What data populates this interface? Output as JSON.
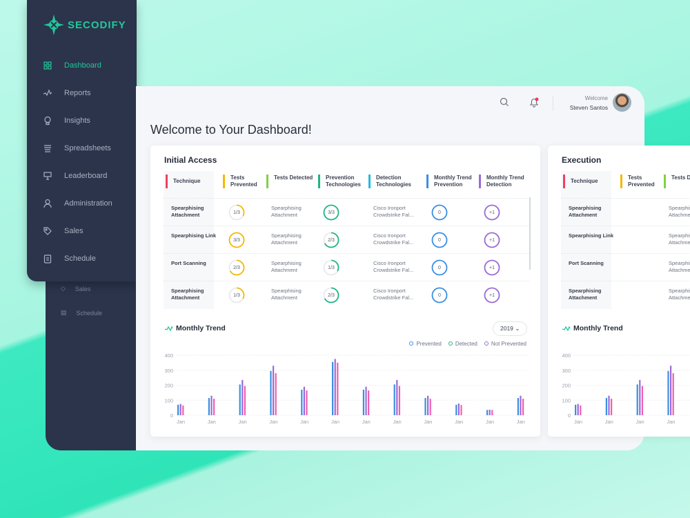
{
  "brand": {
    "name": "SECODIFY",
    "accent": "#20c99a"
  },
  "sidebar": {
    "items": [
      {
        "label": "Dashboard",
        "icon": "grid-icon",
        "active": true
      },
      {
        "label": "Reports",
        "icon": "pulse-icon"
      },
      {
        "label": "Insights",
        "icon": "lightbulb-icon"
      },
      {
        "label": "Spreadsheets",
        "icon": "stack-icon"
      },
      {
        "label": "Leaderboard",
        "icon": "presentation-icon"
      },
      {
        "label": "Administration",
        "icon": "user-icon"
      },
      {
        "label": "Sales",
        "icon": "tag-icon"
      },
      {
        "label": "Schedule",
        "icon": "clipboard-icon"
      }
    ],
    "ghost_items": [
      {
        "label": "Sales",
        "icon": "tag-icon"
      },
      {
        "label": "Schedule",
        "icon": "clipboard-icon"
      }
    ]
  },
  "header": {
    "welcome": "Welcome",
    "user": "Steven Santos",
    "notification_dot": "#f03a5a"
  },
  "page_title": "Welcome to Your Dashboard!",
  "cards": [
    {
      "title": "Initial Access",
      "columns": [
        {
          "label": "Technique",
          "color": "#f0405e"
        },
        {
          "label": "Tests Prevented",
          "color": "#f5b800"
        },
        {
          "label": "Tests Detected",
          "color": "#7fd148"
        },
        {
          "label": "Prevention Technologies",
          "color": "#1db584"
        },
        {
          "label": "Detection Technologies",
          "color": "#22b8e0"
        },
        {
          "label": "Monthly Trend Prevention",
          "color": "#3b8fe0"
        },
        {
          "label": "Monthly Trend Detection",
          "color": "#9b6ad8"
        }
      ],
      "rows": [
        {
          "technique": "Spearphising Attachment",
          "prevented": "1/3",
          "prevented_frac": 0.33,
          "detected": "Spearphising Attachment",
          "prevention_tech": "3/3",
          "prevention_frac": 1,
          "detection_tech": "Cisco Ironport Crowdstrike Fal...",
          "trend_prevention": "0",
          "trend_detection": "+1"
        },
        {
          "technique": "Spearphising Link",
          "prevented": "3/3",
          "prevented_frac": 1,
          "detected": "Spearphising Attachment",
          "prevention_tech": "2/3",
          "prevention_frac": 0.67,
          "detection_tech": "Cisco Ironport Crowdstrike Fal...",
          "trend_prevention": "0",
          "trend_detection": "+1"
        },
        {
          "technique": "Port Scanning",
          "prevented": "2/3",
          "prevented_frac": 0.67,
          "detected": "Spearphising Attachment",
          "prevention_tech": "1/3",
          "prevention_frac": 0.33,
          "detection_tech": "Cisco Ironport Crowdstrike Fal...",
          "trend_prevention": "0",
          "trend_detection": "+1"
        },
        {
          "technique": "Spearphising Attachment",
          "prevented": "1/3",
          "prevented_frac": 0.33,
          "detected": "Spearphising Attachment",
          "prevention_tech": "2/3",
          "prevention_frac": 0.67,
          "detection_tech": "Cisco Ironport Crowdstrike Fal...",
          "trend_prevention": "0",
          "trend_detection": "+1"
        }
      ],
      "trend_title": "Monthly Trend",
      "year": "2019",
      "legend": [
        {
          "label": "Prevented",
          "color": "#3b8fe0"
        },
        {
          "label": "Detected",
          "color": "#1db584"
        },
        {
          "label": "Not Prevented",
          "color": "#9b6ad8"
        }
      ]
    },
    {
      "title": "Execution",
      "columns": [
        {
          "label": "Technique",
          "color": "#f0405e"
        },
        {
          "label": "Tests Prevented",
          "color": "#f5b800"
        },
        {
          "label": "Tests Detected",
          "color": "#7fd148"
        }
      ],
      "rows": [
        {
          "technique": "Spearphising Attachment",
          "detected": "Spearphising Attachment"
        },
        {
          "technique": "Spearphising Link",
          "detected": "Spearphising Attachment"
        },
        {
          "technique": "Port Scanning",
          "detected": "Spearphising Attachment"
        },
        {
          "technique": "Spearphising Attachment",
          "detected": "Spearphising Attachment"
        }
      ],
      "trend_title": "Monthly Trend"
    }
  ],
  "chart_data": [
    {
      "type": "bar",
      "title": "Monthly Trend",
      "ylim": [
        0,
        400
      ],
      "yticks": [
        0,
        100,
        200,
        300,
        400
      ],
      "grid": true,
      "legend": "top-right",
      "categories": [
        "Jan",
        "Jan",
        "Jan",
        "Jan",
        "Jan",
        "Jan",
        "Jan",
        "Jan",
        "Jan",
        "Jan",
        "Jan",
        "Jan"
      ],
      "series": [
        {
          "color": "#3b8fe0",
          "values": [
            70,
            115,
            205,
            295,
            170,
            355,
            170,
            205,
            115,
            70,
            35,
            115
          ]
        },
        {
          "color": "#9b6ad8",
          "values": [
            75,
            130,
            235,
            330,
            190,
            375,
            190,
            235,
            130,
            78,
            37,
            130
          ]
        },
        {
          "color": "#ef5fb0",
          "values": [
            65,
            110,
            195,
            280,
            165,
            350,
            165,
            195,
            110,
            68,
            35,
            110
          ]
        }
      ]
    },
    {
      "type": "bar",
      "title": "Monthly Trend",
      "ylim": [
        0,
        400
      ],
      "yticks": [
        0,
        100,
        200,
        300,
        400
      ],
      "grid": true,
      "categories": [
        "Jan",
        "Jan",
        "Jan",
        "Jan"
      ],
      "series": [
        {
          "color": "#3b8fe0",
          "values": [
            70,
            115,
            205,
            295
          ]
        },
        {
          "color": "#9b6ad8",
          "values": [
            75,
            130,
            235,
            330
          ]
        },
        {
          "color": "#ef5fb0",
          "values": [
            65,
            110,
            195,
            280
          ]
        }
      ]
    }
  ]
}
